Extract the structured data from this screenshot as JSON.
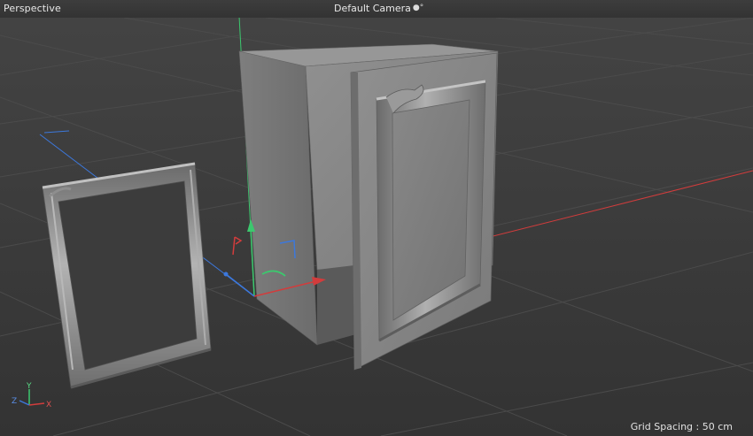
{
  "viewport": {
    "view_name": "Perspective",
    "camera_name": "Default Camera",
    "camera_icon": "camera-toggle-icon",
    "grid_spacing": "Grid Spacing : 50 cm"
  },
  "axis_triad": {
    "x": "X",
    "y": "Y",
    "z": "Z"
  },
  "colors": {
    "background": "#3b3b3b",
    "grid_line": "#4a4a4a",
    "axis_x": "#d23c3c",
    "axis_y": "#3cc86e",
    "axis_z": "#3c78dc",
    "model_gray": "#8a8a8a"
  }
}
